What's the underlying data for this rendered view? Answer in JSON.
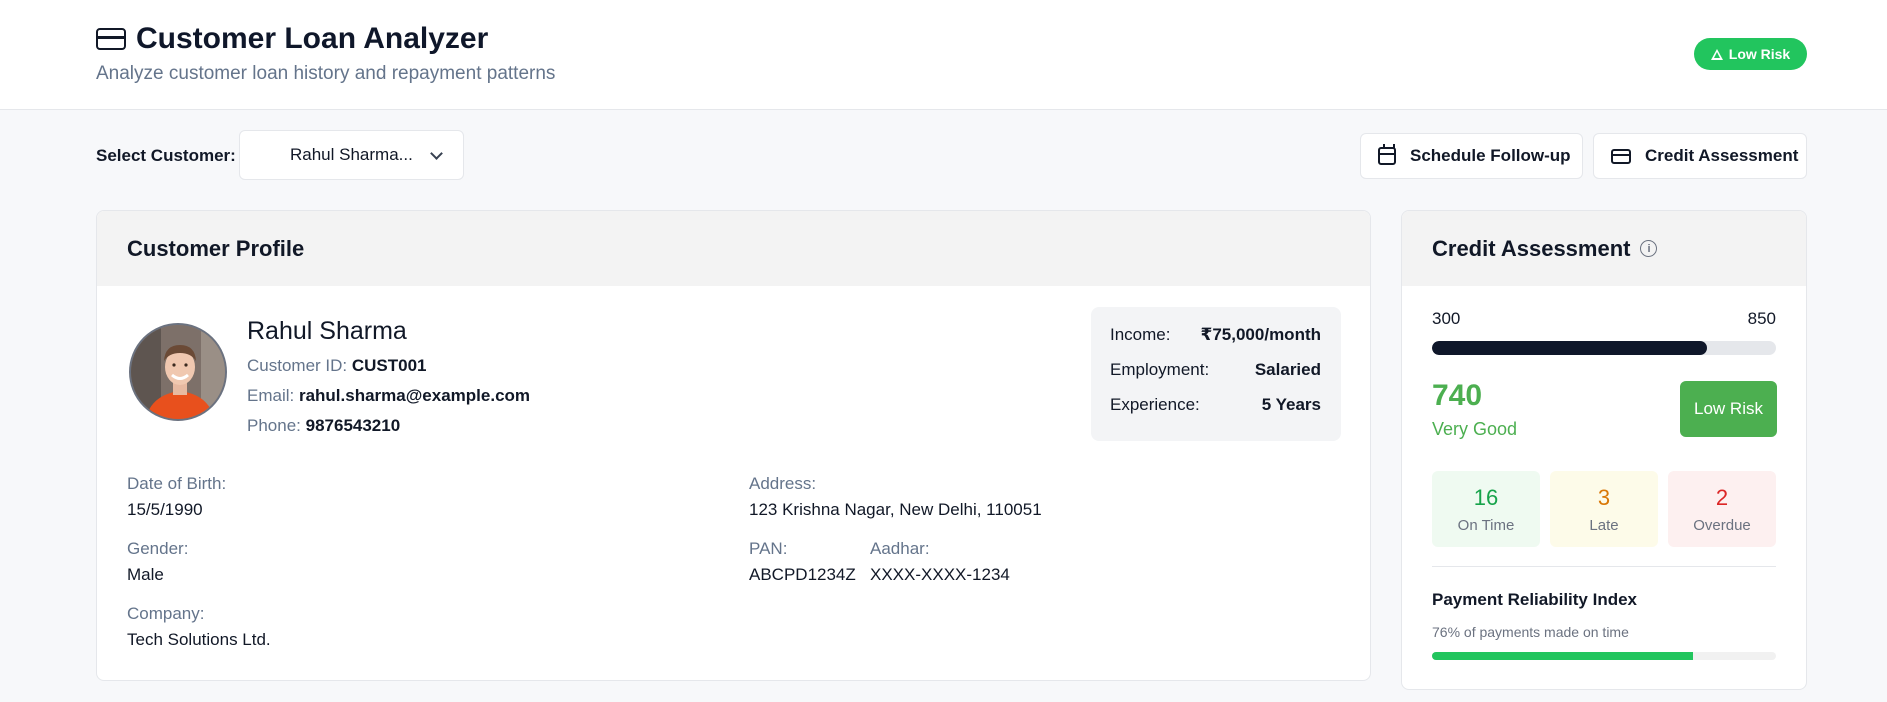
{
  "header": {
    "title": "Customer Loan Analyzer",
    "subtitle": "Analyze customer loan history and repayment patterns",
    "risk_badge": "Low Risk",
    "title_icon": "credit-card-icon",
    "badge_icon": "warning-triangle-icon"
  },
  "toolbar": {
    "select_label": "Select Customer:",
    "selected_customer": "Rahul Sharma...",
    "follow_up_label": "Schedule Follow-up",
    "credit_label": "Credit Assessment"
  },
  "profile": {
    "heading": "Customer Profile",
    "name": "Rahul Sharma",
    "id_label": "Customer ID:",
    "id_value": "CUST001",
    "email_label": "Email:",
    "email_value": "rahul.sharma@example.com",
    "phone_label": "Phone:",
    "phone_value": "9876543210",
    "summary": {
      "income_label": "Income:",
      "income_value": "₹75,000/month",
      "employment_label": "Employment:",
      "employment_value": "Salaried",
      "experience_label": "Experience:",
      "experience_value": "5 Years"
    },
    "dob_label": "Date of Birth:",
    "dob_value": "15/5/1990",
    "gender_label": "Gender:",
    "gender_value": "Male",
    "company_label": "Company:",
    "company_value": "Tech Solutions Ltd.",
    "address_label": "Address:",
    "address_value": "123 Krishna Nagar, New Delhi, 110051",
    "pan_label": "PAN:",
    "pan_value": "ABCPD1234Z",
    "aadhar_label": "Aadhar:",
    "aadhar_value": "XXXX-XXXX-1234"
  },
  "credit": {
    "heading": "Credit Assessment",
    "scale_min": "300",
    "scale_max": "850",
    "score": "740",
    "score_fraction": 0.8,
    "rating": "Very Good",
    "risk_button": "Low Risk",
    "on_time_count": "16",
    "on_time_label": "On Time",
    "late_count": "3",
    "late_label": "Late",
    "overdue_count": "2",
    "overdue_label": "Overdue",
    "reliability_title": "Payment Reliability Index",
    "reliability_text": "76% of payments made on time",
    "reliability_percent": 76,
    "colors": {
      "good": "#4caf50",
      "late": "#d97706",
      "overdue": "#dc2626",
      "badge": "#22c55e"
    }
  }
}
